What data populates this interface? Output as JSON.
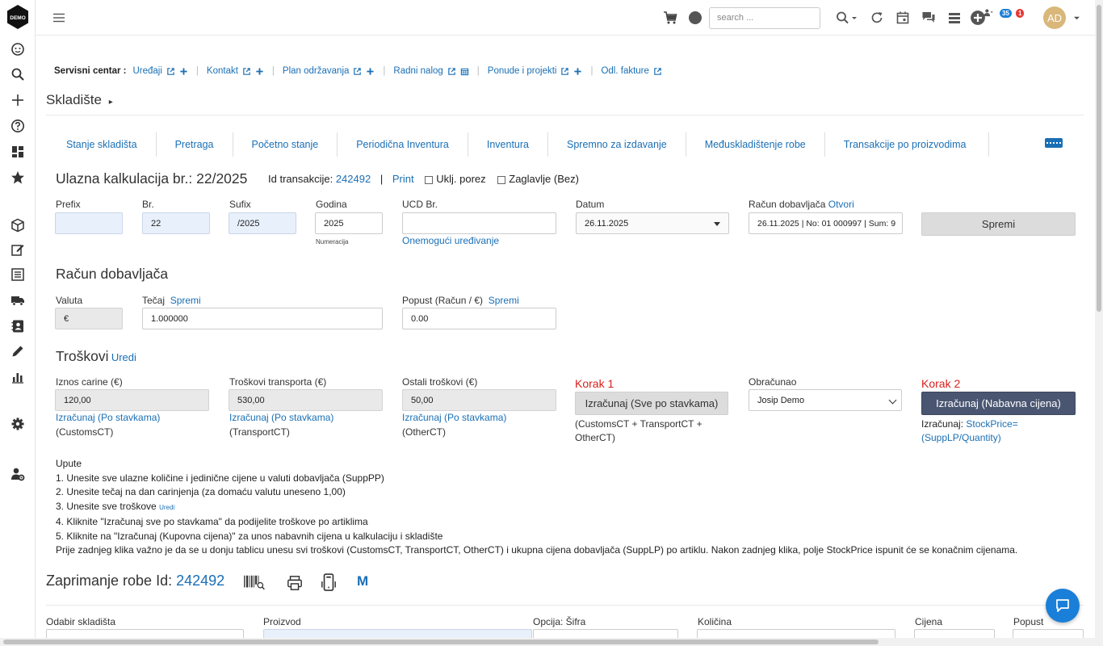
{
  "logo_text": "DEMO",
  "topbar": {
    "search_placeholder": "search ...",
    "badge_users": "35",
    "badge_alerts": "1",
    "avatar_initials": "AD"
  },
  "service_center": {
    "label": "Servisni centar :",
    "items": [
      "Uređaji",
      "Kontakt",
      "Plan održavanja",
      "Radni nalog",
      "Ponude i projekti",
      "Odl. fakture"
    ]
  },
  "section_title": "Skladište",
  "tabs": [
    "Stanje skladišta",
    "Pretraga",
    "Početno stanje",
    "Periodična Inventura",
    "Inventura",
    "Spremno za izdavanje",
    "Međuskladištenje robe",
    "Transakcije po proizvodima"
  ],
  "header": {
    "title": "Ulazna kalkulacija br.: 22/2025",
    "trans_label": "Id transakcije:",
    "trans_id": "242492",
    "sep": "|",
    "print": "Print",
    "ukljporez": "Uklj. porez",
    "zaglavlje": "Zaglavlje (Bez)"
  },
  "form1": {
    "prefix_label": "Prefix",
    "prefix_value": "",
    "br_label": "Br.",
    "br_value": "22",
    "sufix_label": "Sufix",
    "sufix_value": "/2025",
    "godina_label": "Godina",
    "godina_value": "2025",
    "numeracija": "Numeracija",
    "ucd_label": "UCD Br.",
    "ucd_value": "",
    "disable_edit": "Onemogući uređivanje",
    "datum_label": "Datum",
    "datum_value": "26.11.2025",
    "racun_label": "Račun dobavljača",
    "racun_link": "Otvori",
    "racun_value": "26.11.2025 | No: 01 000997 | Sum: 9",
    "save": "Spremi"
  },
  "supplier": {
    "title": "Račun dobavljača",
    "valuta_label": "Valuta",
    "valuta_value": "€",
    "tecaj_label": "Tečaj",
    "tecaj_link": "Spremi",
    "tecaj_value": "1.000000",
    "popust_label": "Popust (Račun / €)",
    "popust_link": "Spremi",
    "popust_value": "0.00"
  },
  "costs": {
    "title": "Troškovi",
    "edit": "Uredi",
    "carine_label": "Iznos carine (€)",
    "carine_value": "120,00",
    "carine_calc": "Izračunaj (Po stavkama)",
    "carine_code": "(CustomsCT)",
    "transport_label": "Troškovi transporta (€)",
    "transport_value": "530,00",
    "transport_calc": "Izračunaj (Po stavkama)",
    "transport_code": "(TransportCT)",
    "ostali_label": "Ostali troškovi (€)",
    "ostali_value": "50,00",
    "ostali_calc": "Izračunaj (Po stavkama)",
    "ostali_code": "(OtherCT)",
    "korak1": "Korak 1",
    "korak1_btn": "Izračunaj (Sve po stavkama)",
    "korak1_formula": "(CustomsCT + TransportCT + OtherCT)",
    "obracunao_label": "Obračunao",
    "obracunao_value": "Josip Demo",
    "korak2": "Korak 2",
    "korak2_btn": "Izračunaj (Nabavna cijena)",
    "korak2_prefix": "Izračunaj:",
    "korak2_formula": "StockPrice= (SuppLP/Quantity)"
  },
  "instructions": {
    "title": "Upute",
    "l1": "1. Unesite sve ulazne količine i jedinične cijene u valuti dobavljača (SuppPP)",
    "l2": "2. Unesite tečaj na dan carinjenja (za domaću valutu uneseno 1,00)",
    "l3": "3. Unesite sve troškove",
    "l3_link": "Uredi",
    "l4": "4. Kliknite \"Izračunaj sve po stavkama\" da podijelite troškove po artiklima",
    "l5": "5. Kliknite na \"Izračunaj (Kupovna cijena)\" za unos nabavnih cijena u kalkulaciju i skladište",
    "note": "Prije zadnjeg klika važno je da se u donju tablicu unesu svi troškovi (CustomsCT, TransportCT, OtherCT) i ukupna cijena dobavljača (SuppLP) po artiklu. Nakon zadnjeg klika, polje StockPrice ispunit će se konačnim cijenama."
  },
  "receipt": {
    "title": "Zaprimanje robe Id:",
    "id": "242492",
    "m": "M",
    "cols": {
      "skladiste": "Odabir skladišta",
      "proizvod": "Proizvod",
      "opcija": "Opcija: Šifra",
      "kolicina": "Količina",
      "cijena": "Cijena",
      "popust": "Popust"
    }
  }
}
